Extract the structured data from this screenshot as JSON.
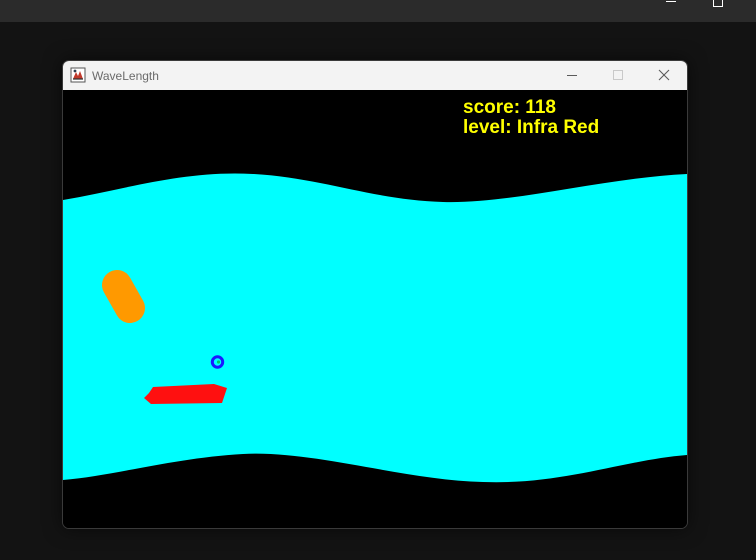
{
  "window": {
    "title": "WaveLength",
    "controls": {
      "minimize_icon": "minimize-icon",
      "maximize_icon": "maximize-icon",
      "close_icon": "close-icon"
    }
  },
  "hud": {
    "score_text": "score: 118",
    "level_text": "level: Infra Red"
  },
  "colors": {
    "background": "#000000",
    "wave": "#00ffff",
    "hud_text": "#ffff00",
    "player_ship": "#ff1010",
    "obstacle": "#ff9900",
    "ring": "#1a1aff"
  },
  "game": {
    "objects": [
      "wave-band",
      "obstacle-capsule",
      "ring-pickup",
      "player-ship"
    ]
  }
}
